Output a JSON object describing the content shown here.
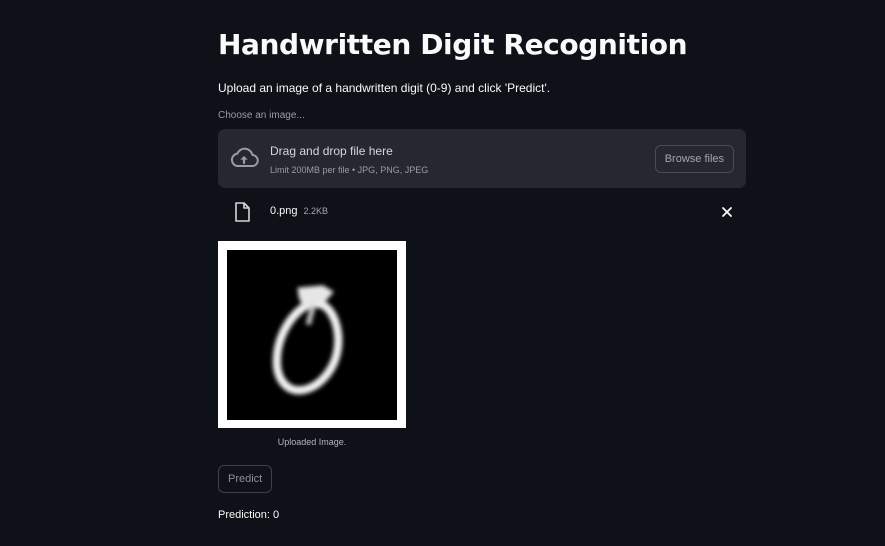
{
  "page": {
    "title": "Handwritten Digit Recognition",
    "description": "Upload an image of a handwritten digit (0-9) and click 'Predict'."
  },
  "uploader": {
    "label": "Choose an image...",
    "dropzone_title": "Drag and drop file here",
    "dropzone_limit": "Limit 200MB per file • JPG, PNG, JPEG",
    "browse_label": "Browse files",
    "icon": "cloud-upload-icon"
  },
  "uploaded_file": {
    "name": "0.png",
    "size": "2.2KB",
    "icon": "file-icon",
    "remove_icon": "close-icon"
  },
  "image": {
    "caption": "Uploaded Image.",
    "content": "handwritten digit 0 on black background"
  },
  "actions": {
    "predict_label": "Predict"
  },
  "result": {
    "text": "Prediction: 0"
  },
  "colors": {
    "background": "#0e1117",
    "dropzone": "#262730",
    "text": "#fafafa",
    "muted_text": "#9a9ca3"
  }
}
